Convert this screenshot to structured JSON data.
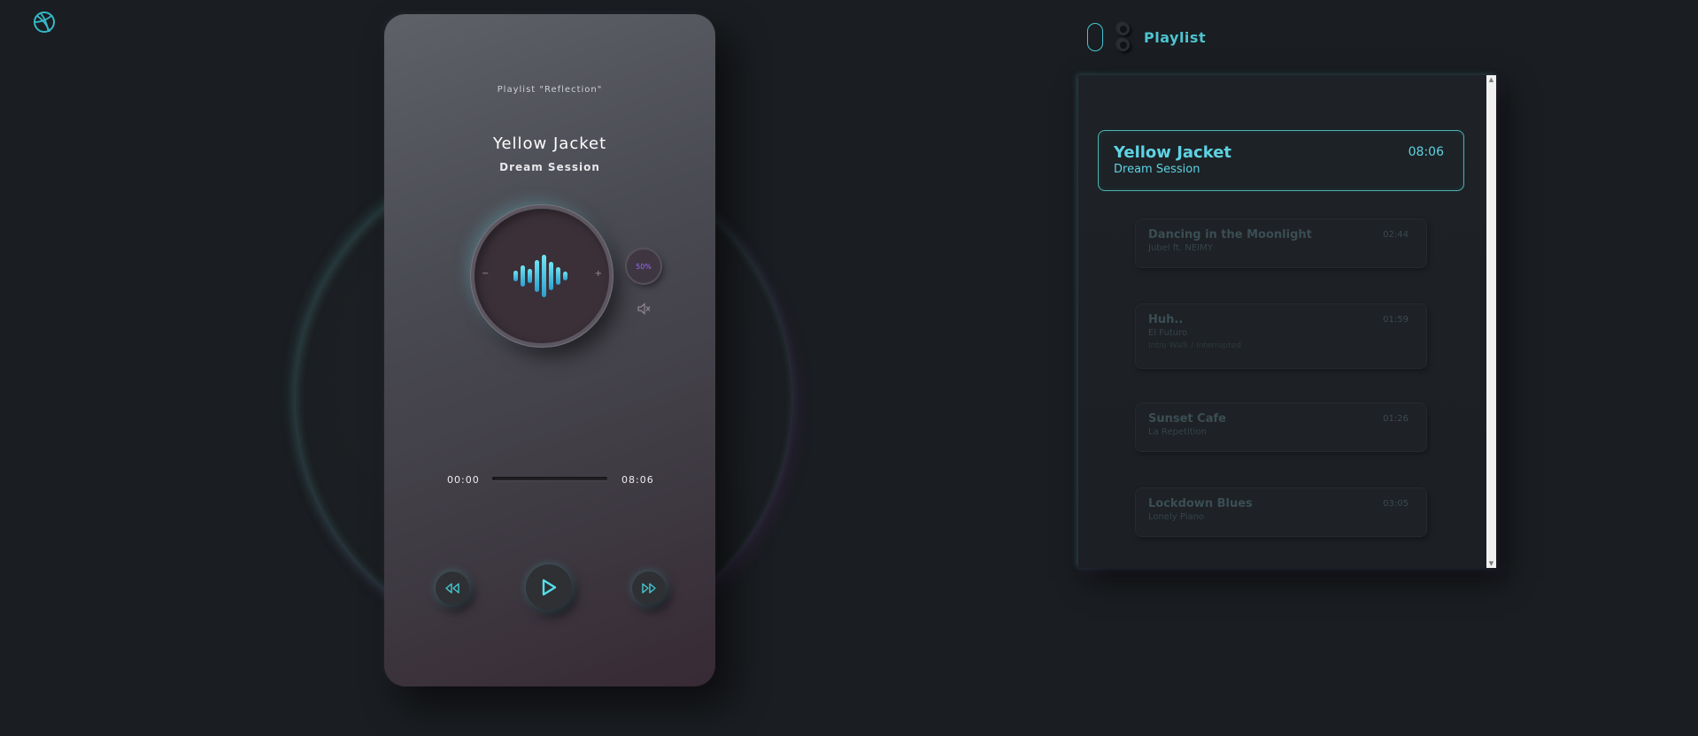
{
  "phone": {
    "playlist_label": "Playlist \"Reflection\"",
    "song_title": "Yellow Jacket",
    "artist": "Dream Session",
    "knob_minus": "−",
    "knob_plus": "+",
    "volume": "50%",
    "current_time": "00:00",
    "total_time": "08:06",
    "progress": 0
  },
  "playlist": {
    "title": "Playlist",
    "items": [
      {
        "name": "Yellow Jacket",
        "artist": "Dream Session",
        "duration": "08:06",
        "active": true
      },
      {
        "name": "Dancing in the Moonlight",
        "artist": "Jubel ft. NEIMY",
        "duration": "02:44"
      },
      {
        "name": "Huh..",
        "artist": "El Futuro",
        "extra": "Intro Walk / Interrupted",
        "duration": "01:59"
      },
      {
        "name": "Sunset Cafe",
        "artist": "La Repetition",
        "duration": "01:26"
      },
      {
        "name": "Lockdown Blues",
        "artist": "Lonely Piano",
        "duration": "03:05"
      }
    ]
  },
  "colors": {
    "accent": "#55e0ea",
    "volume": "#9b6cff",
    "background": "#1a1d21"
  },
  "icons": [
    "dribbble-icon",
    "sound-wave-icon",
    "speaker-muted-icon",
    "rewind-icon",
    "play-icon",
    "fast-forward-icon"
  ]
}
